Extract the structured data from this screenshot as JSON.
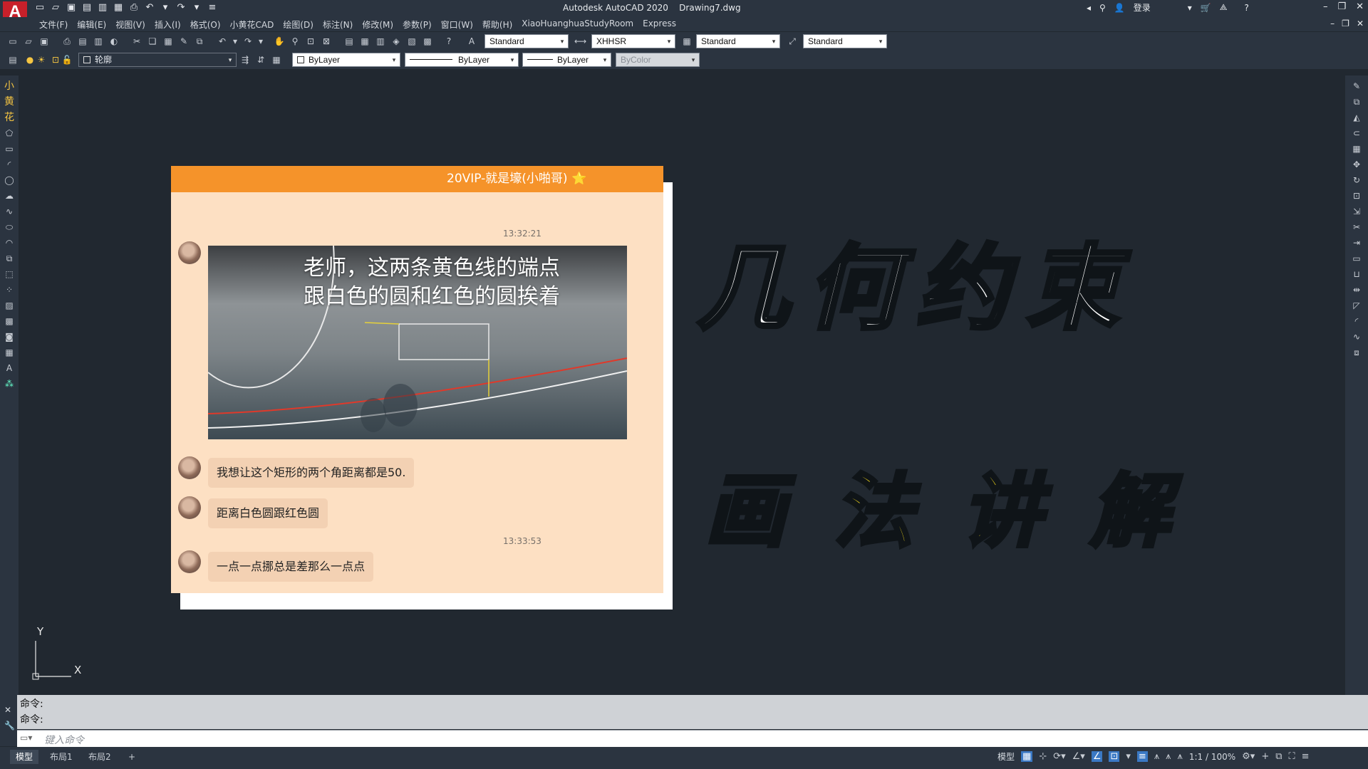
{
  "app": {
    "title": "Autodesk AutoCAD 2020    Drawing7.dwg",
    "logo_letter": "A",
    "signin": "登录",
    "extra_tabs": [
      "XiaoHuanghuaStudyRoom",
      "Express"
    ]
  },
  "menus": [
    "文件(F)",
    "编辑(E)",
    "视图(V)",
    "插入(I)",
    "格式(O)",
    "小黄花CAD",
    "绘图(D)",
    "标注(N)",
    "修改(M)",
    "参数(P)",
    "窗口(W)",
    "帮助(H)",
    "XiaoHuanghuaStudyRoom",
    "Express"
  ],
  "toolbar": {
    "text_style": "Standard",
    "dim_style": "XHHSR",
    "table_style": "Standard",
    "mleader_style": "Standard",
    "layer": "轮廓",
    "color": "ByLayer",
    "linetype": "ByLayer",
    "lineweight": "ByLayer",
    "plot_style": "ByColor"
  },
  "left_toolbar_labels": [
    "小",
    "黄",
    "花"
  ],
  "chat": {
    "header": "20VIP-就是壕(小啪哥) ⭐",
    "timestamp1": "13:32:21",
    "photo_caption_line1": "老师，这两条黄色线的端点",
    "photo_caption_line2": "跟白色的圆和红色的圆挨着",
    "msg1": "我想让这个矩形的两个角距离都是50.",
    "msg2": "距离白色圆跟红色圆",
    "timestamp2": "13:33:53",
    "msg3": "一点一点挪总是差那么一点点"
  },
  "headline": {
    "line1": "几何约束",
    "line2": "画法讲解"
  },
  "ucs": {
    "x_label": "X",
    "y_label": "Y"
  },
  "command": {
    "history": [
      "命令:",
      "命令:"
    ],
    "placeholder": "键入命令"
  },
  "layout_tabs": [
    "模型",
    "布局1",
    "布局2",
    "+"
  ],
  "status": {
    "model": "模型",
    "scale": "1:1 / 100%"
  },
  "colors": {
    "chat_header": "#f5932a",
    "chat_bg": "#fde0c3",
    "headline2": "#ffe21a",
    "canvas_bg": "#212830"
  }
}
